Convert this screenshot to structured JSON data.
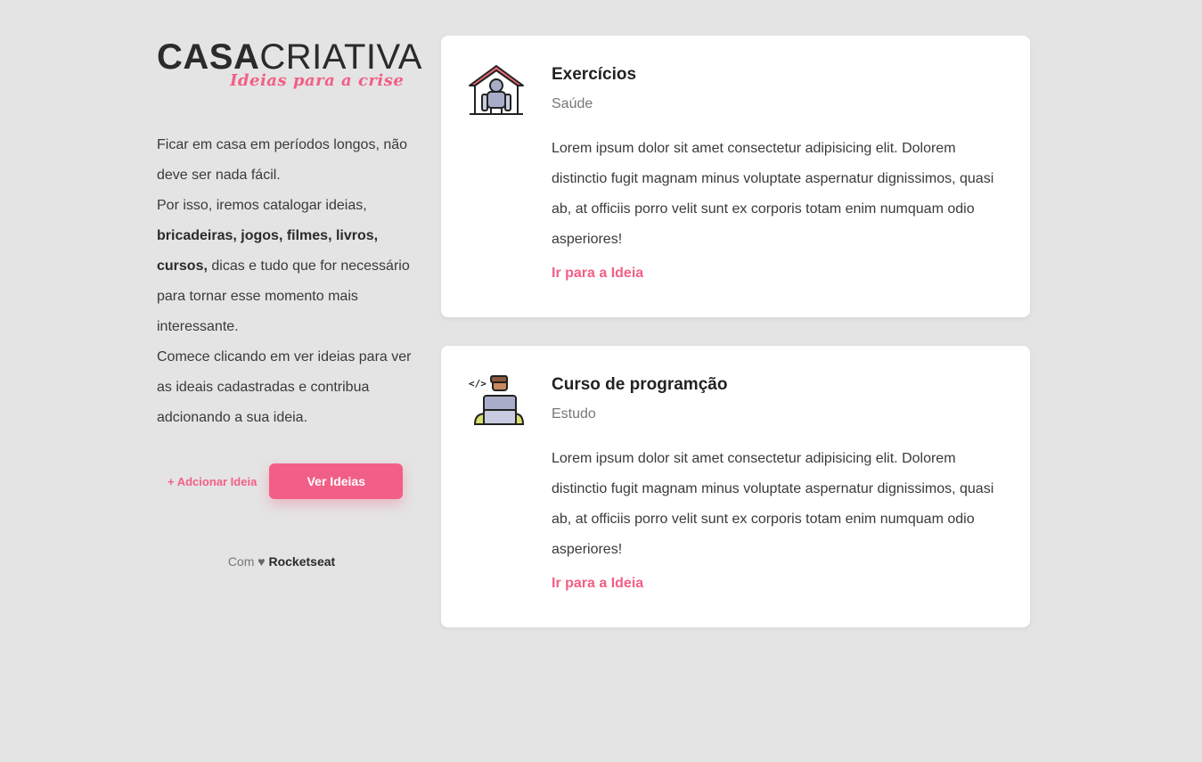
{
  "brand": {
    "logo_bold": "CASA",
    "logo_thin": "CRIATIVA",
    "tagline": "Ideias para a crise"
  },
  "sidebar": {
    "intro_1": "Ficar em casa em períodos longos, não deve ser nada fácil.",
    "intro_2": "Por isso, iremos catalogar ideias,",
    "intro_bold": "bricadeiras, jogos, filmes, livros, cursos,",
    "intro_3": " dicas e tudo que for necessário para tornar esse momento mais interessante.",
    "intro_4": "Comece clicando em ver ideias para ver as ideais cadastradas e contribua adcionando a sua ideia.",
    "add_label": "+ Adcionar Ideia",
    "view_label": "Ver Ideias",
    "footer_prefix": "Com",
    "footer_heart": "♥",
    "footer_brand": "Rocketseat"
  },
  "cards": [
    {
      "title": "Exercícios",
      "category": "Saúde",
      "description": "Lorem ipsum dolor sit amet consectetur adipisicing elit. Dolorem distinctio fugit magnam minus voluptate aspernatur dignissimos, quasi ab, at officiis porro velit sunt ex corporis totam enim numquam odio asperiores!",
      "link": "Ir para a Ideia",
      "icon": "home-workout-icon"
    },
    {
      "title": "Curso de programção",
      "category": "Estudo",
      "description": "Lorem ipsum dolor sit amet consectetur adipisicing elit. Dolorem distinctio fugit magnam minus voluptate aspernatur dignissimos, quasi ab, at officiis porro velit sunt ex corporis totam enim numquam odio asperiores!",
      "link": "Ir para a Ideia",
      "icon": "programmer-icon"
    }
  ],
  "colors": {
    "accent": "#f25f86",
    "background": "#e4e4e4",
    "card": "#ffffff"
  }
}
